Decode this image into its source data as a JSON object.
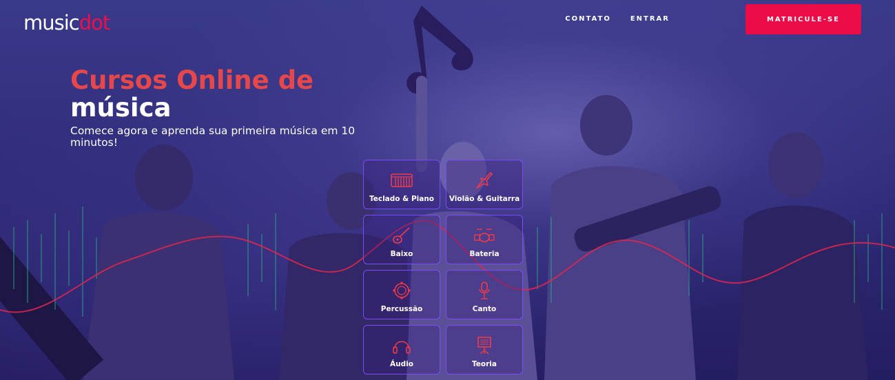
{
  "brand": {
    "logo_part1": "music",
    "logo_part2": "dot",
    "accent_color": "#ec0a47"
  },
  "nav": {
    "items": [
      {
        "label": "CONTATO"
      },
      {
        "label": "ENTRAR"
      }
    ],
    "cta_label": "MATRICULE-SE"
  },
  "hero": {
    "title_line1": "Cursos Online de",
    "title_line2": "música",
    "subtitle": "Comece agora e aprenda sua primeira música em 10 minutos!"
  },
  "courses": [
    {
      "label": "Teclado & Piano",
      "icon": "keyboard-icon"
    },
    {
      "label": "Violão & Guitarra",
      "icon": "guitar-icon"
    },
    {
      "label": "Baixo",
      "icon": "bass-icon"
    },
    {
      "label": "Bateria",
      "icon": "drums-icon"
    },
    {
      "label": "Percussão",
      "icon": "tambourine-icon"
    },
    {
      "label": "Canto",
      "icon": "microphone-icon"
    },
    {
      "label": "Áudio",
      "icon": "headphones-icon"
    },
    {
      "label": "Teoria",
      "icon": "sheet-music-icon"
    }
  ]
}
